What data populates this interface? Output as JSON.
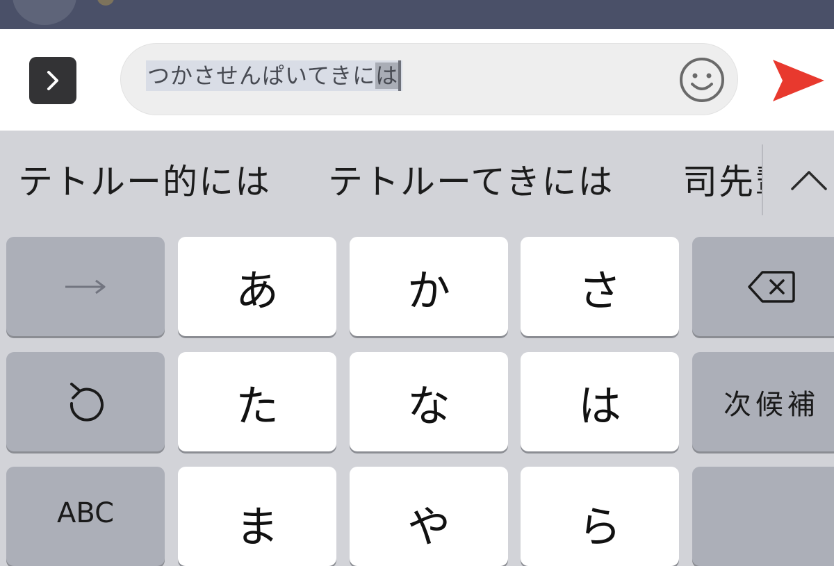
{
  "input": {
    "text_main": "つかさせんぱいてきに",
    "text_highlighted": "は"
  },
  "candidates": [
    "テトルー的には",
    "テトルーてきには",
    "司先輩"
  ],
  "keyboard": {
    "row1": {
      "kana_a": "あ",
      "kana_ka": "か",
      "kana_sa": "さ"
    },
    "row2": {
      "kana_ta": "た",
      "kana_na": "な",
      "kana_ha": "は",
      "next_candidate": "次候補"
    },
    "row3": {
      "abc": "ABC",
      "kana_ma": "ま",
      "kana_ya": "や",
      "kana_ra": "ら"
    }
  },
  "icons": {
    "expand": "chevron-right-icon",
    "emoji": "smiley-face-icon",
    "send": "paper-plane-send-icon",
    "arrow_right": "arrow-right-icon",
    "backspace": "backspace-icon",
    "undo": "undo-icon",
    "collapse": "chevron-up-icon"
  },
  "colors": {
    "send_accent": "#e8392e",
    "header": "#4a5068"
  }
}
